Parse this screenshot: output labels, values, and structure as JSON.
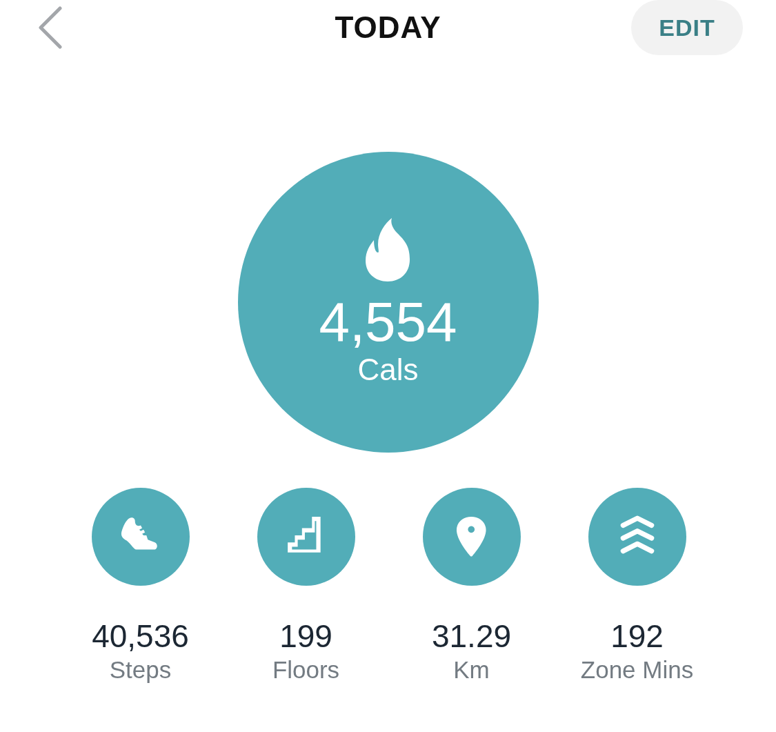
{
  "header": {
    "title": "TODAY",
    "edit_button": "EDIT"
  },
  "main_stat": {
    "kind": "calories",
    "value": "4,554",
    "label": "Cals"
  },
  "stats": [
    {
      "kind": "steps",
      "value": "40,536",
      "label": "Steps"
    },
    {
      "kind": "floors",
      "value": "199",
      "label": "Floors"
    },
    {
      "kind": "distance",
      "value": "31.29",
      "label": "Km"
    },
    {
      "kind": "zone",
      "value": "192",
      "label": "Zone Mins"
    }
  ]
}
